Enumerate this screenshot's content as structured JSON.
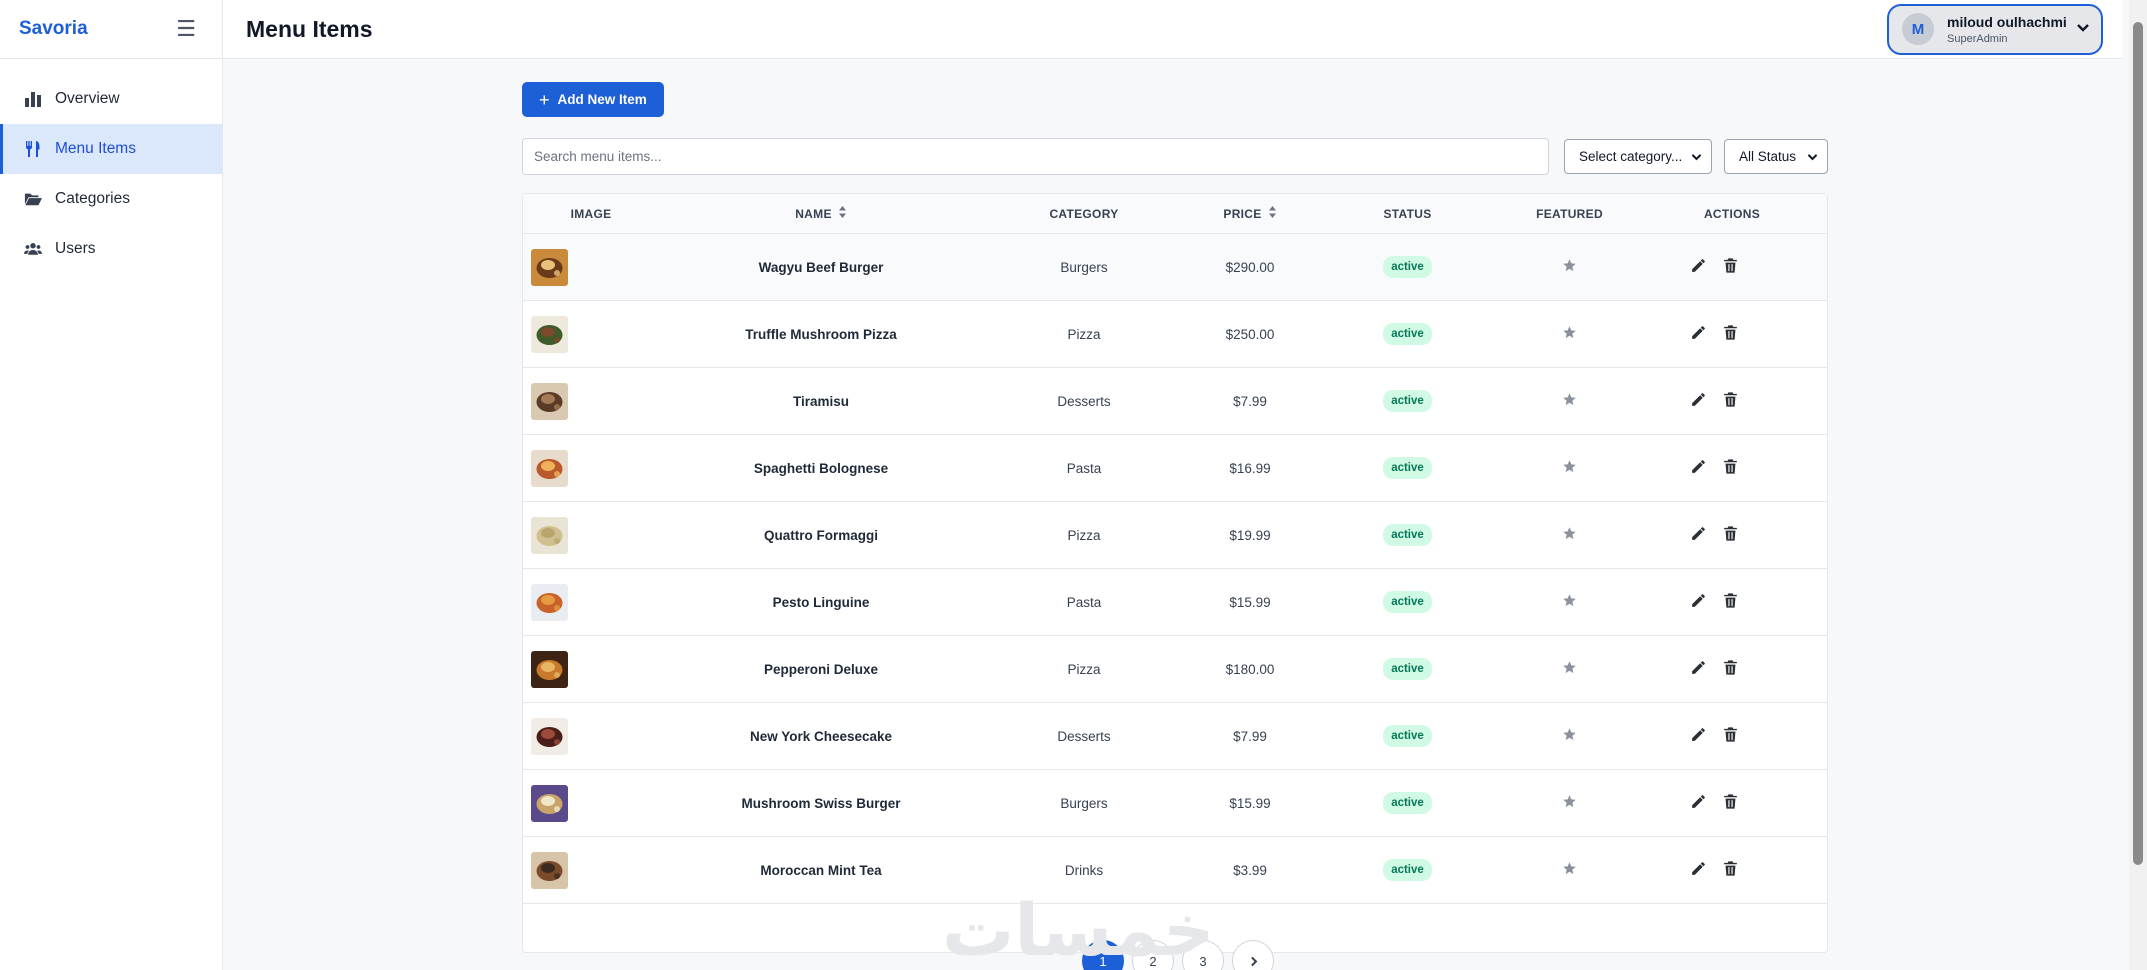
{
  "brand": "Savoria",
  "header": {
    "title": "Menu Items"
  },
  "user": {
    "initial": "M",
    "name": "miloud oulhachmi",
    "role": "SuperAdmin"
  },
  "sidebar": {
    "items": [
      {
        "label": "Overview",
        "icon": "bar-chart-icon",
        "active": false
      },
      {
        "label": "Menu Items",
        "icon": "utensils-icon",
        "active": true
      },
      {
        "label": "Categories",
        "icon": "folder-open-icon",
        "active": false
      },
      {
        "label": "Users",
        "icon": "users-icon",
        "active": false
      }
    ]
  },
  "toolbar": {
    "add_label": "Add New Item"
  },
  "filters": {
    "search_placeholder": "Search menu items...",
    "category_label": "Select category...",
    "status_label": "All Status"
  },
  "table": {
    "headers": {
      "image": "IMAGE",
      "name": "NAME",
      "category": "CATEGORY",
      "price": "PRICE",
      "status": "STATUS",
      "featured": "FEATURED",
      "actions": "ACTIONS"
    },
    "rows": [
      {
        "name": "Wagyu Beef Burger",
        "category": "Burgers",
        "price": "$290.00",
        "status": "active"
      },
      {
        "name": "Truffle Mushroom Pizza",
        "category": "Pizza",
        "price": "$250.00",
        "status": "active"
      },
      {
        "name": "Tiramisu",
        "category": "Desserts",
        "price": "$7.99",
        "status": "active"
      },
      {
        "name": "Spaghetti Bolognese",
        "category": "Pasta",
        "price": "$16.99",
        "status": "active"
      },
      {
        "name": "Quattro Formaggi",
        "category": "Pizza",
        "price": "$19.99",
        "status": "active"
      },
      {
        "name": "Pesto Linguine",
        "category": "Pasta",
        "price": "$15.99",
        "status": "active"
      },
      {
        "name": "Pepperoni Deluxe",
        "category": "Pizza",
        "price": "$180.00",
        "status": "active"
      },
      {
        "name": "New York Cheesecake",
        "category": "Desserts",
        "price": "$7.99",
        "status": "active"
      },
      {
        "name": "Mushroom Swiss Burger",
        "category": "Burgers",
        "price": "$15.99",
        "status": "active"
      },
      {
        "name": "Moroccan Mint Tea",
        "category": "Drinks",
        "price": "$3.99",
        "status": "active"
      }
    ]
  },
  "pagination": {
    "pages": [
      "1",
      "2",
      "3"
    ],
    "current": "1"
  },
  "watermark": "خمسات",
  "colors": {
    "accent": "#1d5fd6",
    "active_badge_bg": "#d1fae5",
    "active_badge_text": "#047857"
  }
}
